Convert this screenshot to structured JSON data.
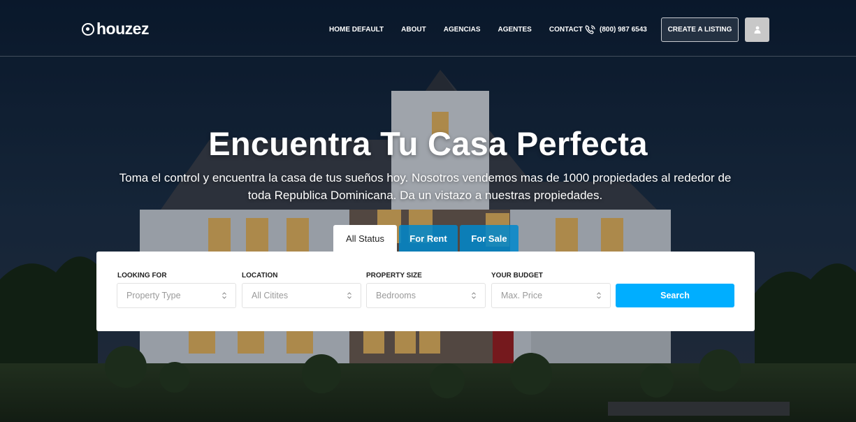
{
  "brand": {
    "name": "houzez"
  },
  "nav": {
    "items": [
      "HOME DEFAULT",
      "ABOUT",
      "AGENCIAS",
      "AGENTES",
      "CONTACT"
    ],
    "phone": "(800) 987 6543",
    "create_listing": "CREATE A LISTING"
  },
  "hero": {
    "title": "Encuentra Tu Casa Perfecta",
    "subtitle": "Toma el control y encuentra la casa de tus sueños hoy. Nosotros vendemos mas de 1000 propiedades al rededor de toda Republica Dominicana. Da un vistazo a nuestras propiedades."
  },
  "tabs": [
    "All Status",
    "For Rent",
    "For Sale"
  ],
  "search": {
    "fields": [
      {
        "label": "LOOKING FOR",
        "value": "Property Type"
      },
      {
        "label": "LOCATION",
        "value": "All Citites"
      },
      {
        "label": "PROPERTY SIZE",
        "value": "Bedrooms"
      },
      {
        "label": "YOUR BUDGET",
        "value": "Max. Price"
      }
    ],
    "button": "Search"
  },
  "colors": {
    "accent": "#00aeff",
    "tab_active_bg": "#0088cc"
  }
}
